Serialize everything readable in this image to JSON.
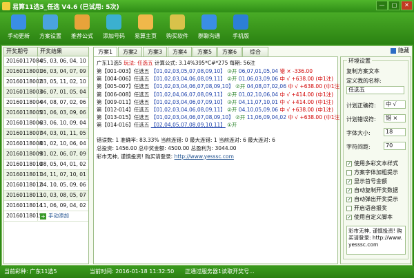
{
  "title": "易算11选5_任选 V4.6 (已试用: 5次)",
  "toolbar": [
    {
      "label": "手动更新",
      "icon": "refresh-icon",
      "color": "#3a8ee6"
    },
    {
      "label": "方案设置",
      "icon": "settings-icon",
      "color": "#4aa3df"
    },
    {
      "label": "推荐公式",
      "icon": "formula-icon",
      "color": "#e8a33a"
    },
    {
      "label": "添加号码",
      "icon": "add-number-icon",
      "color": "#3bb0d0"
    },
    {
      "label": "易算主页",
      "icon": "home-icon",
      "color": "#f0b84a"
    },
    {
      "label": "购买软件",
      "icon": "key-icon",
      "color": "#d9c24a"
    },
    {
      "label": "群聊沟通",
      "icon": "group-chat-icon",
      "color": "#3a8ee6"
    },
    {
      "label": "手机版",
      "icon": "phone-icon",
      "color": "#2c7fd6"
    }
  ],
  "left": {
    "headers": [
      "开奖期号",
      "开奖结果"
    ],
    "rows": [
      [
        "20160117084",
        "05, 03, 06, 04, 10"
      ],
      [
        "20160118001",
        "06, 03, 04, 07, 09"
      ],
      [
        "20160118002",
        "03, 05, 11, 02, 10"
      ],
      [
        "20160118003",
        "06, 07, 01, 05, 04"
      ],
      [
        "20160118004",
        "04, 08, 07, 02, 06"
      ],
      [
        "20160118005",
        "01, 06, 03, 09, 06"
      ],
      [
        "20160118006",
        "03, 06, 10, 09, 04"
      ],
      [
        "20160118007",
        "04, 03, 01, 11, 05"
      ],
      [
        "20160118008",
        "01, 02, 10, 06, 04"
      ],
      [
        "20160118009",
        "01, 02, 06, 07, 09"
      ],
      [
        "20160118010",
        "08, 05, 04, 01, 02"
      ],
      [
        "20160118011",
        "04, 11, 07, 10, 01"
      ],
      [
        "20160118012",
        "04, 10, 05, 09, 06"
      ],
      [
        "20160118013",
        "10, 03, 08, 05, 07"
      ],
      [
        "20160118014",
        "11, 06, 09, 04, 02"
      ]
    ],
    "last_id": "20160118015",
    "add_label": "手动添加"
  },
  "tabs": [
    "方案1",
    "方案2",
    "方案3",
    "方案4",
    "方案5",
    "方案6",
    "综合"
  ],
  "hide_label": "隐藏",
  "content": {
    "lottery": "广东11选5",
    "play_label": "玩法: 任选五",
    "formula": "计算公式: 3.14%395*C#*275",
    "period": "每期: 56注",
    "rows": [
      {
        "range": "第【001-003】任选五",
        "nums": "【01,02,03,05,07,08,09,10】",
        "mark": "③开",
        "draw": "06,07,01,05,04",
        "result": "错",
        "sign": "×",
        "amount": "-336.00",
        "note": ""
      },
      {
        "range": "第【004-006】任选五",
        "nums": "【01,02,03,04,06,08,09,11】",
        "mark": "②开",
        "draw": "01,06,03,09,06",
        "result": "中",
        "sign": "√",
        "amount": "+638.00",
        "note": "(中1注)"
      },
      {
        "range": "第【005-007】任选五",
        "nums": "【01,02,03,04,06,07,08,09,10】",
        "mark": "②开",
        "draw": "04,08,07,02,06",
        "result": "中",
        "sign": "√",
        "amount": "+638.00",
        "note": "(中1注)"
      },
      {
        "range": "第【006-008】任选五",
        "nums": "【01,02,04,06,07,08,09,11】",
        "mark": "②开",
        "draw": "01,02,10,06,04",
        "result": "中",
        "sign": "√",
        "amount": "+414.00",
        "note": "(中1注)"
      },
      {
        "range": "第【009-011】任选五",
        "nums": "【01,02,03,04,06,07,09,10】",
        "mark": "③开",
        "draw": "04,11,07,10,01",
        "result": "中",
        "sign": "√",
        "amount": "+414.00",
        "note": "(中1注)"
      },
      {
        "range": "第【012-014】任选五",
        "nums": "【01,02,03,04,06,08,09,11】",
        "mark": "②开",
        "draw": "04,10,05,09,06",
        "result": "中",
        "sign": "√",
        "amount": "+638.00",
        "note": "(中1注)"
      },
      {
        "range": "第【013-015】任选五",
        "nums": "【01,02,03,04,06,07,08,09,10】",
        "mark": "②开",
        "draw": "11,06,09,04,02",
        "result": "中",
        "sign": "√",
        "amount": "+638.00",
        "note": "(中1注)"
      },
      {
        "range": "第【014-016】任选五",
        "nums": "【02,04,05,07,08,09,10,11】",
        "mark": "①开",
        "draw": "",
        "result": "",
        "sign": "",
        "amount": "",
        "note": ""
      }
    ],
    "stats1": "错误数: 1  准确率: 83.33%  当前连错: 0  最大连错: 1  当前连对: 6  最大连对: 6",
    "stats2": "总投资: 1456.00  总中奖金额: 4500.00  总盈利为: 3044.00",
    "warn": "彩市无神, 谨慎投资! 购买请登录: ",
    "url": "http://www.yesssc.com"
  },
  "right": {
    "group_title": "环境设置",
    "copy_label": "复制方案文本",
    "name_label": "定义我的名称:",
    "name_value": "任选五",
    "right_label": "计划正确符:",
    "right_value": "中 √",
    "wrong_label": "计划错误符:",
    "wrong_value": "错 ×",
    "size_label": "字体大小:",
    "size_value": "18",
    "gap_label": "字符间距:",
    "gap_value": "70",
    "checks": [
      {
        "label": "使用多彩文本样式",
        "checked": true
      },
      {
        "label": "方案字体加粗提示",
        "checked": false
      },
      {
        "label": "显示首号金额",
        "checked": true
      },
      {
        "label": "自动复制开奖数据",
        "checked": true
      },
      {
        "label": "自动弹出开奖提示",
        "checked": true
      },
      {
        "label": "开启语音报奖",
        "checked": false
      },
      {
        "label": "使用自定义脚本",
        "checked": true
      }
    ],
    "note_text": "彩市无神, 谨慎投资! 购买请登录: http://www.yesssc.com"
  },
  "status": {
    "lottery_label": "当前彩种: 广东11选5",
    "time_label": "当前时间: 2016-01-18 11:32:50",
    "server_label": "正通过服务器1读取开奖号..."
  }
}
